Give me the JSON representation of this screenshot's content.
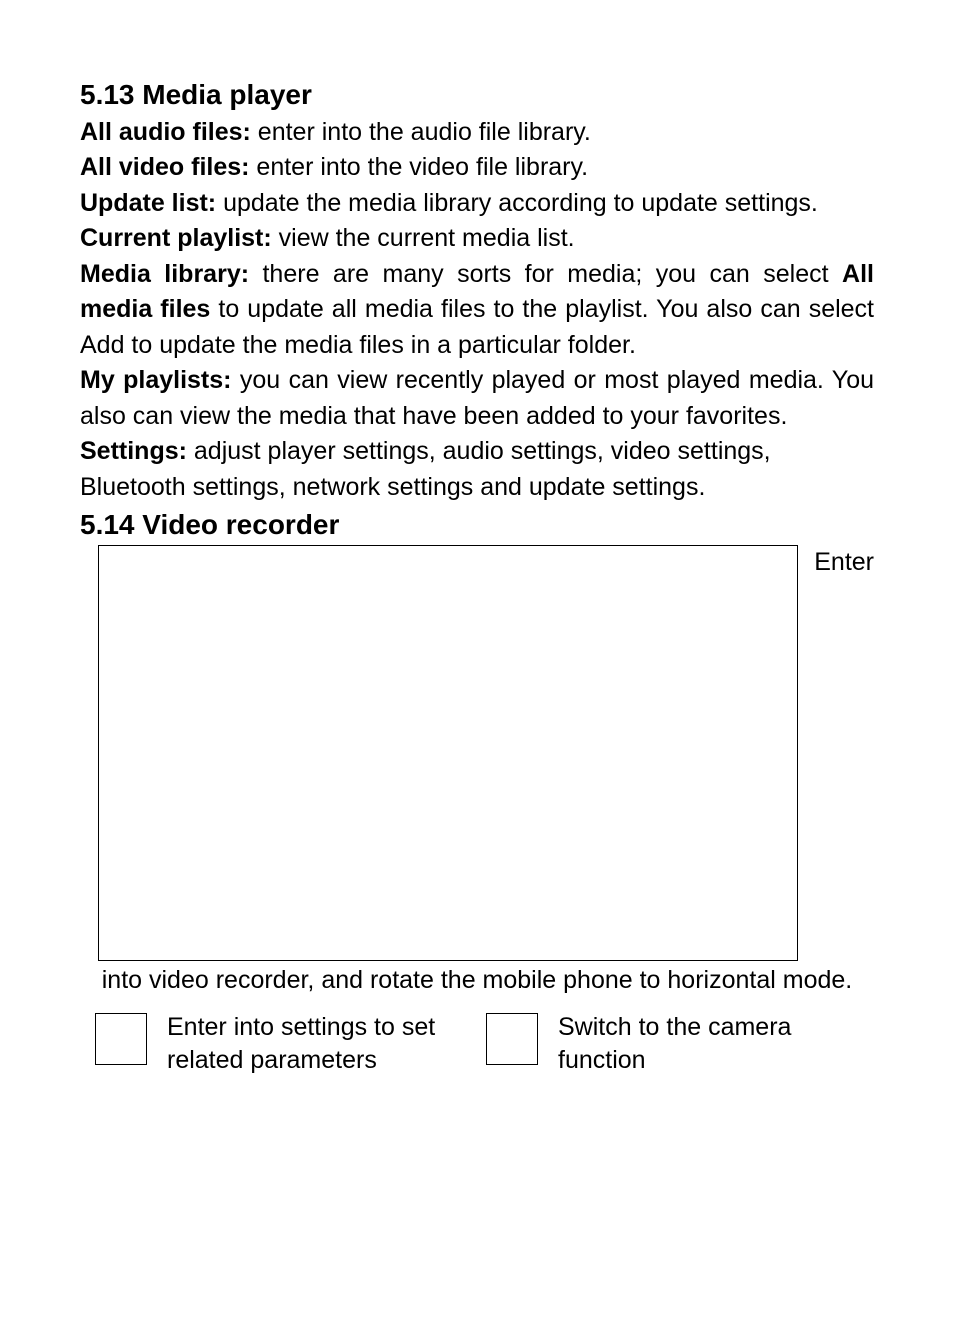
{
  "section513": {
    "heading": "5.13 Media player",
    "items": [
      {
        "label": "All audio files:",
        "text": " enter into the audio file library."
      },
      {
        "label": "All video files:",
        "text": " enter into the video file library."
      },
      {
        "label": "Update list:",
        "text": " update the media library according to update settings."
      },
      {
        "label": "Current playlist:",
        "text": " view the current media list."
      }
    ],
    "mediaLibrary": {
      "label": "Media library:",
      "pre": " there are many sorts for media; you can select ",
      "bold": "All media files",
      "post": " to update all media files to the playlist. You also can select Add to update the media files in a particular folder."
    },
    "myPlaylists": {
      "label": "My playlists:",
      "text": " you can view recently played or most played media. You also can view the media that have been added to your favorites."
    },
    "settings": {
      "label": "Settings:",
      "text": " adjust player settings, audio settings, video settings, Bluetooth settings, network settings and update settings."
    }
  },
  "section514": {
    "heading": "5.14 Video recorder",
    "enter": "Enter",
    "continuation": "into video recorder, and rotate the mobile phone to horizontal mode.",
    "icons": [
      {
        "text": "Enter into settings to set related parameters"
      },
      {
        "text": "Switch to the camera function"
      }
    ]
  }
}
